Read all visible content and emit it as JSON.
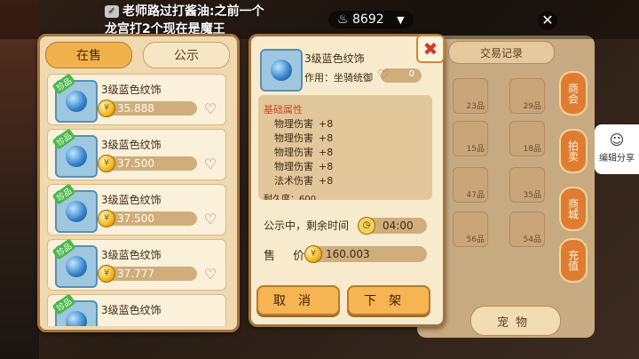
{
  "overlay": {
    "ticker_badge": "✓",
    "ticker_line1": "老师路过打酱油:之前一个",
    "ticker_line2": "龙宫打2个现在是魔王",
    "heat_icon": "fire-icon",
    "heat_value": "8692",
    "heat_arrow": "▼",
    "close_glyph": "✕"
  },
  "background": {
    "trade_tab": "交易记录",
    "side_tabs": [
      "商会",
      "拍卖",
      "商城",
      "充值"
    ],
    "share_label": "编辑分享",
    "pet_button": "宠物",
    "tiles": [
      "23品",
      "29品",
      "15品",
      "18品",
      "47品",
      "35品",
      "56品",
      "54品"
    ]
  },
  "list": {
    "tabs": [
      "在售",
      "公示"
    ],
    "active_tab": 0,
    "tag": "珍品",
    "coin_glyph": "¥",
    "items": [
      {
        "name": "3级蓝色纹饰",
        "price": "35.888"
      },
      {
        "name": "3级蓝色纹饰",
        "price": "37.500"
      },
      {
        "name": "3级蓝色纹饰",
        "price": "37.500"
      },
      {
        "name": "3级蓝色纹饰",
        "price": "37.777"
      },
      {
        "name": "3级蓝色纹饰",
        "price": ""
      }
    ]
  },
  "detail": {
    "name": "3级蓝色纹饰",
    "use": "作用：坐骑统御",
    "favorites": "0",
    "attr_title": "基础属性",
    "attrs": [
      {
        "label": "物理伤害",
        "value": "+8"
      },
      {
        "label": "物理伤害",
        "value": "+8"
      },
      {
        "label": "物理伤害",
        "value": "+8"
      },
      {
        "label": "物理伤害",
        "value": "+8"
      },
      {
        "label": "法术伤害",
        "value": "+8"
      }
    ],
    "durability": "耐久度：600",
    "timer_label": "公示中，剩余时间",
    "timer_value": "04:00",
    "sell_label": "售 价",
    "sell_price": "160.003",
    "cancel_button": "取消",
    "unlist_button": "下架",
    "close_glyph": "✖"
  }
}
